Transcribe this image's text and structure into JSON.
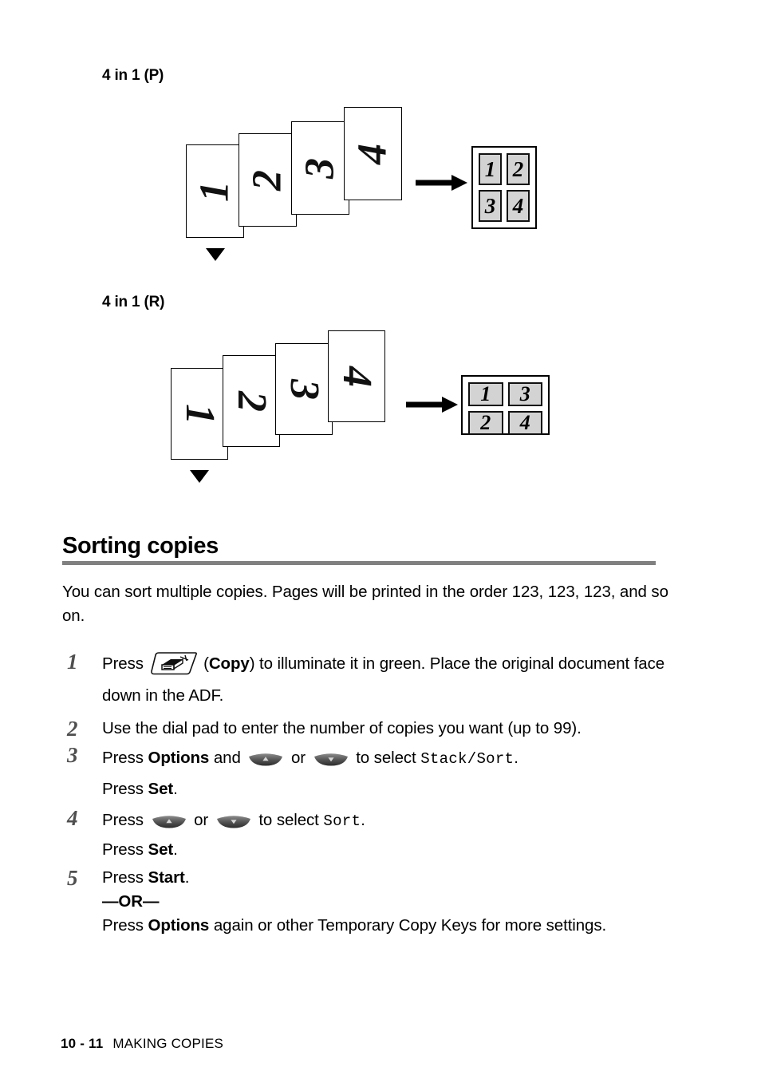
{
  "page": {
    "footer": {
      "page_number": "10 - 11",
      "chapter": "MAKING COPIES"
    }
  },
  "diagrams": [
    {
      "label": "4 in 1 (P)",
      "icon": "down-triangle-icon",
      "arrow": "right-arrow-icon",
      "source_sheets": [
        "1",
        "2",
        "3",
        "4"
      ],
      "result_layout": "portrait-2x2",
      "result_cells": [
        "1",
        "2",
        "3",
        "4"
      ]
    },
    {
      "label": "4 in 1 (R)",
      "icon": "down-triangle-icon",
      "arrow": "right-arrow-icon",
      "source_sheets": [
        "1",
        "2",
        "3",
        "4"
      ],
      "result_layout": "landscape-2x2",
      "result_cells": [
        "1",
        "3",
        "2",
        "4"
      ]
    }
  ],
  "section": {
    "heading": "Sorting copies",
    "intro": "You can sort multiple copies. Pages will be printed in the order 123, 123, 123, and so on."
  },
  "steps": [
    {
      "number": "1",
      "parts": [
        {
          "t": "text",
          "v": "Press "
        },
        {
          "t": "icon",
          "v": "copy-key-icon"
        },
        {
          "t": "text",
          "v": " ("
        },
        {
          "t": "bold",
          "v": "Copy"
        },
        {
          "t": "text",
          "v": ") to illuminate it in green. Place the original document face down in the ADF."
        }
      ]
    },
    {
      "number": "2",
      "parts": [
        {
          "t": "text",
          "v": "Use the dial pad to enter the number of copies you want (up to 99)."
        }
      ]
    },
    {
      "number": "3",
      "parts": [
        {
          "t": "text",
          "v": "Press "
        },
        {
          "t": "bold",
          "v": "Options"
        },
        {
          "t": "text",
          "v": " and "
        },
        {
          "t": "icon",
          "v": "nav-up-key-icon"
        },
        {
          "t": "text",
          "v": " or "
        },
        {
          "t": "icon",
          "v": "nav-down-key-icon"
        },
        {
          "t": "text",
          "v": " to select "
        },
        {
          "t": "mono",
          "v": "Stack/Sort"
        },
        {
          "t": "text",
          "v": "."
        },
        {
          "t": "br",
          "v": ""
        },
        {
          "t": "text",
          "v": "Press "
        },
        {
          "t": "bold",
          "v": "Set"
        },
        {
          "t": "text",
          "v": "."
        }
      ]
    },
    {
      "number": "4",
      "parts": [
        {
          "t": "text",
          "v": "Press "
        },
        {
          "t": "icon",
          "v": "nav-up-key-icon"
        },
        {
          "t": "text",
          "v": " or "
        },
        {
          "t": "icon",
          "v": "nav-down-key-icon"
        },
        {
          "t": "text",
          "v": " to select "
        },
        {
          "t": "mono",
          "v": "Sort"
        },
        {
          "t": "text",
          "v": "."
        },
        {
          "t": "br",
          "v": ""
        },
        {
          "t": "text",
          "v": "Press "
        },
        {
          "t": "bold",
          "v": "Set"
        },
        {
          "t": "text",
          "v": "."
        }
      ]
    },
    {
      "number": "5",
      "parts": [
        {
          "t": "text",
          "v": "Press "
        },
        {
          "t": "bold",
          "v": "Start"
        },
        {
          "t": "text",
          "v": "."
        },
        {
          "t": "br",
          "v": ""
        },
        {
          "t": "bold",
          "v": "—OR—"
        },
        {
          "t": "br",
          "v": ""
        },
        {
          "t": "text",
          "v": "Press "
        },
        {
          "t": "bold",
          "v": "Options"
        },
        {
          "t": "text",
          "v": " again or other Temporary Copy Keys for more settings."
        }
      ]
    }
  ],
  "colors": {
    "rule": "#808080",
    "step_number": "#4f4f4f",
    "cell_fill": "#d3d3d3",
    "ink": "#000000"
  }
}
